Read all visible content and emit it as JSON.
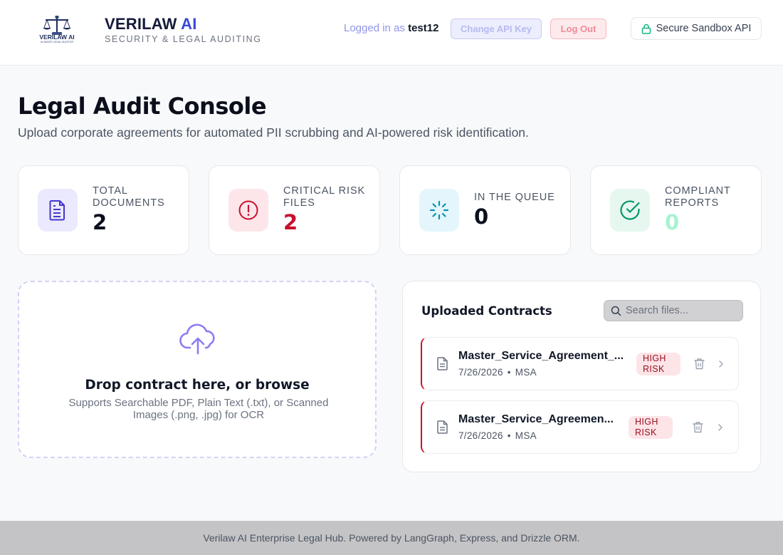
{
  "header": {
    "brand_name": "VERILAW",
    "brand_ai": "AI",
    "brand_subtitle": "SECURITY & LEGAL AUDITING",
    "logo_text": "VERILAW AI",
    "logo_tagline": "AI-BASED LEGAL AUDITOR",
    "logged_in_prefix": "Logged in as",
    "username": "test12",
    "change_api_key_label": "Change API Key",
    "logout_label": "Log Out",
    "sandbox_label": "Secure Sandbox API"
  },
  "page": {
    "title": "Legal Audit Console",
    "subtitle": "Upload corporate agreements for automated PII scrubbing and AI-powered risk identification."
  },
  "stats": [
    {
      "label": "Total Documents",
      "value": "2",
      "icon": "document-icon",
      "color": "#4338ca",
      "bg": "#ebe9fe"
    },
    {
      "label": "Critical Risk Files",
      "value": "2",
      "icon": "alert-circle-icon",
      "color": "#c8102e",
      "bg": "#fde6ea"
    },
    {
      "label": "In the Queue",
      "value": "0",
      "icon": "loader-icon",
      "color": "#0891b2",
      "bg": "#e4f6fb"
    },
    {
      "label": "Compliant Reports",
      "value": "0",
      "icon": "check-circle-icon",
      "color": "#a7f3d0",
      "bg": "#e6f7ef"
    }
  ],
  "dropzone": {
    "title": "Drop contract here, or browse",
    "subtitle": "Supports Searchable PDF, Plain Text (.txt), or Scanned Images (.png, .jpg) for OCR",
    "icon": "cloud-upload-icon"
  },
  "contracts": {
    "title": "Uploaded Contracts",
    "search_placeholder": "Search files...",
    "items": [
      {
        "name": "Master_Service_Agreement_...",
        "date": "7/26/2026",
        "separator": "•",
        "type": "MSA",
        "risk": "HIGH RISK"
      },
      {
        "name": "Master_Service_Agreemen...",
        "date": "7/26/2026",
        "separator": "•",
        "type": "MSA",
        "risk": "HIGH RISK"
      }
    ]
  },
  "footer": {
    "text": "Verilaw AI Enterprise Legal Hub. Powered by LangGraph, Express, and Drizzle ORM."
  },
  "colors": {
    "accent": "#3b47d8",
    "danger": "#c8102e",
    "upload": "#8b7cf6"
  }
}
